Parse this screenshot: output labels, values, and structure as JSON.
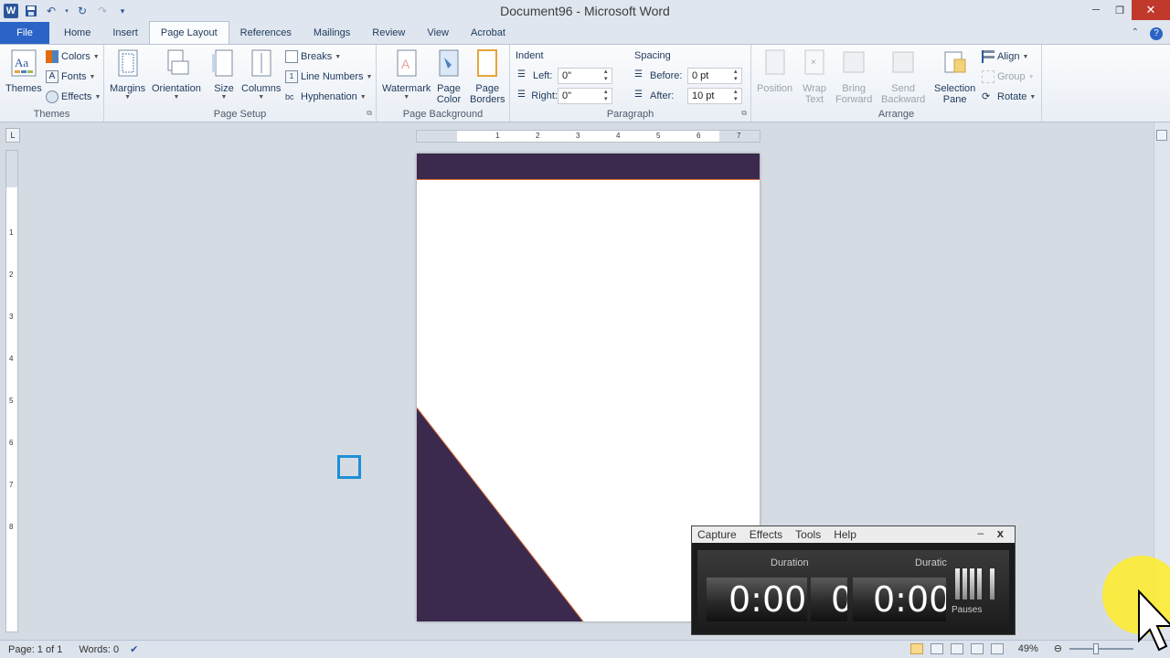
{
  "window": {
    "title": "Document96  -  Microsoft Word"
  },
  "quick_access": {
    "app_icon_letter": "W"
  },
  "tabs": [
    {
      "label": "File"
    },
    {
      "label": "Home"
    },
    {
      "label": "Insert"
    },
    {
      "label": "Page Layout"
    },
    {
      "label": "References"
    },
    {
      "label": "Mailings"
    },
    {
      "label": "Review"
    },
    {
      "label": "View"
    },
    {
      "label": "Acrobat"
    }
  ],
  "ribbon": {
    "themes": {
      "group_label": "Themes",
      "themes_label": "Themes",
      "colors_label": "Colors",
      "fonts_label": "Fonts",
      "effects_label": "Effects"
    },
    "page_setup": {
      "group_label": "Page Setup",
      "margins_label": "Margins",
      "orientation_label": "Orientation",
      "size_label": "Size",
      "columns_label": "Columns",
      "breaks_label": "Breaks",
      "line_numbers_label": "Line Numbers",
      "hyphenation_label": "Hyphenation"
    },
    "page_background": {
      "group_label": "Page Background",
      "watermark_label": "Watermark",
      "page_color_label_1": "Page",
      "page_color_label_2": "Color",
      "page_borders_label_1": "Page",
      "page_borders_label_2": "Borders"
    },
    "paragraph": {
      "group_label": "Paragraph",
      "indent_title": "Indent",
      "spacing_title": "Spacing",
      "left_label": "Left:",
      "left_value": "0\"",
      "right_label": "Right:",
      "right_value": "0\"",
      "before_label": "Before:",
      "before_value": "0 pt",
      "after_label": "After:",
      "after_value": "10 pt"
    },
    "arrange": {
      "group_label": "Arrange",
      "position_label": "Position",
      "wrap_text_label_1": "Wrap",
      "wrap_text_label_2": "Text",
      "bring_forward_label_1": "Bring",
      "bring_forward_label_2": "Forward",
      "send_backward_label_1": "Send",
      "send_backward_label_2": "Backward",
      "selection_pane_label_1": "Selection",
      "selection_pane_label_2": "Pane",
      "align_label": "Align",
      "group_btn_label": "Group",
      "rotate_label": "Rotate"
    }
  },
  "ruler": {
    "h_numbers": [
      "1",
      "2",
      "3",
      "4",
      "5",
      "6",
      "7"
    ],
    "v_numbers": [
      "1",
      "2",
      "3",
      "4",
      "5",
      "6",
      "7",
      "8"
    ],
    "tab_selector": "L"
  },
  "document": {
    "header_band_color": "#3b2a4d",
    "corner_shape_color": "#3b2a4d",
    "accent_line_color": "#e0703a"
  },
  "status": {
    "page": "Page: 1 of 1",
    "words": "Words: 0",
    "zoom": "49%"
  },
  "recorder": {
    "menu": [
      "Capture",
      "Effects",
      "Tools",
      "Help"
    ],
    "minimize": "–",
    "close": "x",
    "duration_label_1": "Duration",
    "duration_label_2": "Duratic",
    "time_1": "0:00:",
    "time_partial": "0",
    "time_2": "0:00",
    "pauses_label": "Pauses"
  }
}
